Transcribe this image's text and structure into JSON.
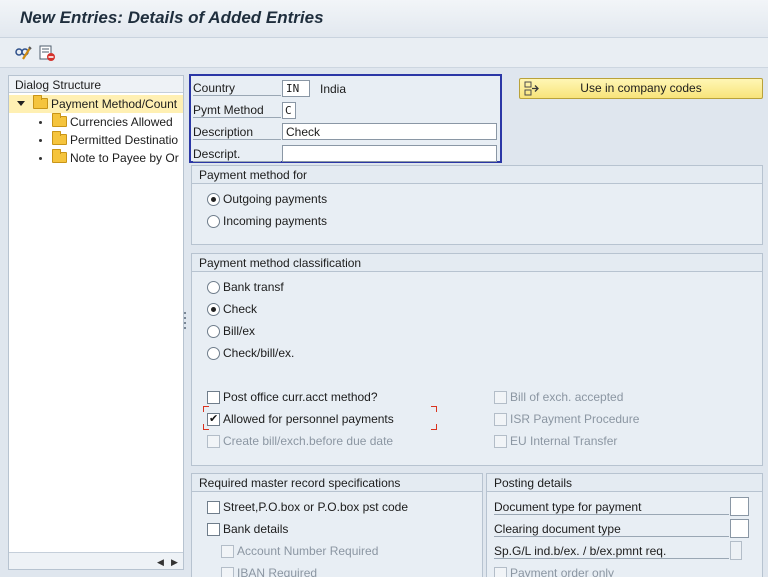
{
  "window": {
    "title": "New Entries: Details of Added Entries"
  },
  "toolbar": {
    "icons": [
      "glasses-change-icon",
      "delete-row-icon"
    ]
  },
  "dialog_structure": {
    "header": "Dialog Structure",
    "root": "Payment Method/Count",
    "children": [
      "Currencies Allowed",
      "Permitted Destinatio",
      "Note to Payee by Or"
    ]
  },
  "key_fields": {
    "country_label": "Country",
    "country_value": "IN",
    "country_text": "India",
    "pymt_method_label": "Pymt Method",
    "pymt_method_value": "C",
    "description_label": "Description",
    "description_value": "Check",
    "descript_label": "Descript.",
    "descript_value": ""
  },
  "use_button": {
    "label": "Use in company codes"
  },
  "payment_for": {
    "title": "Payment method for",
    "options": [
      "Outgoing payments",
      "Incoming payments"
    ],
    "selected": "Outgoing payments"
  },
  "classification": {
    "title": "Payment method classification",
    "options": [
      "Bank transf",
      "Check",
      "Bill/ex",
      "Check/bill/ex."
    ],
    "selected": "Check",
    "checks_left": [
      {
        "label": "Post office curr.acct method?",
        "checked": false,
        "enabled": true
      },
      {
        "label": "Allowed for personnel payments",
        "checked": true,
        "enabled": true
      },
      {
        "label": "Create bill/exch.before due date",
        "checked": false,
        "enabled": false
      }
    ],
    "checks_right": [
      {
        "label": "Bill of exch. accepted",
        "checked": false,
        "enabled": false
      },
      {
        "label": "ISR Payment Procedure",
        "checked": false,
        "enabled": false
      },
      {
        "label": "EU Internal Transfer",
        "checked": false,
        "enabled": false
      }
    ]
  },
  "master_record": {
    "title": "Required master record specifications",
    "items": [
      "Street,P.O.box or P.O.box pst code",
      "Bank details"
    ],
    "sub_items": [
      "Account Number Required",
      "IBAN Required"
    ]
  },
  "posting": {
    "title": "Posting details",
    "doc_type_label": "Document type for payment",
    "clearing_label": "Clearing document type",
    "spgl_label": "Sp.G/L ind.b/ex. / b/ex.pmnt req.",
    "payment_order_label": "Payment order only"
  }
}
